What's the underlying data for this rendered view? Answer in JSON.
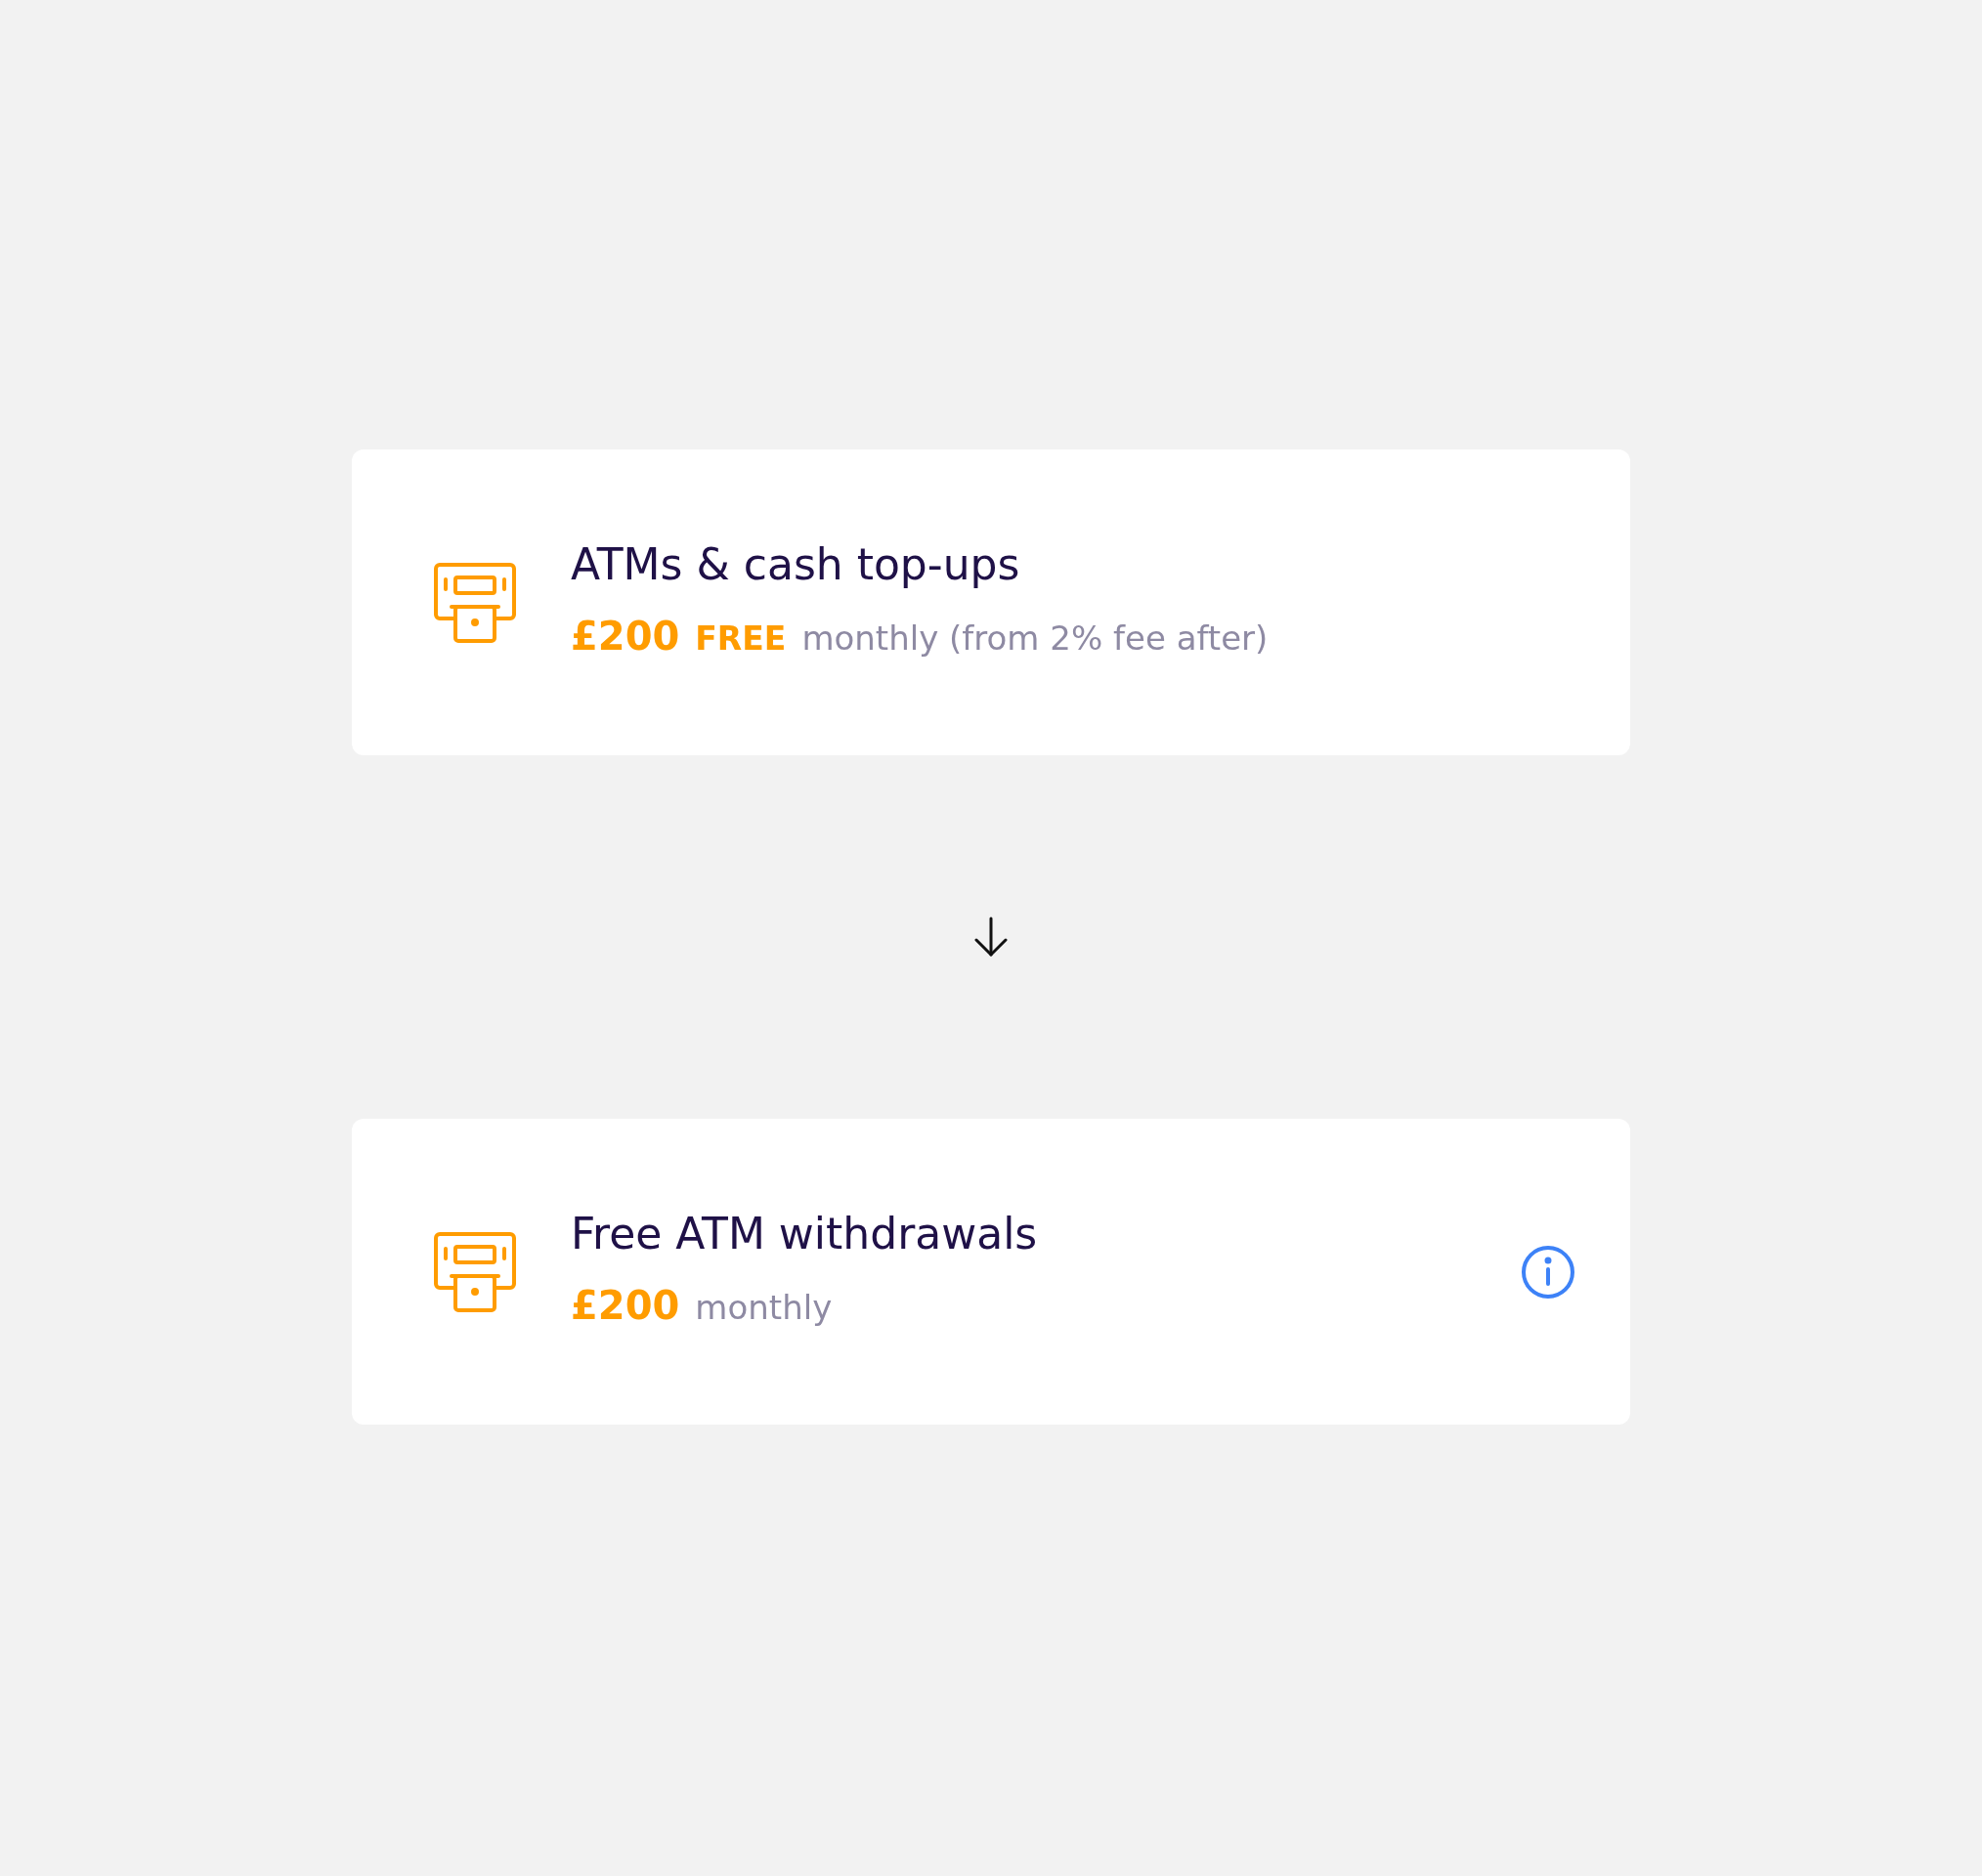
{
  "cards": [
    {
      "title": "ATMs & cash top-ups",
      "amount": "£200",
      "tag": "FREE",
      "detail": "monthly (from 2% fee after)",
      "info": false
    },
    {
      "title": "Free ATM withdrawals",
      "amount": "£200",
      "detail": "monthly",
      "info": true
    }
  ]
}
